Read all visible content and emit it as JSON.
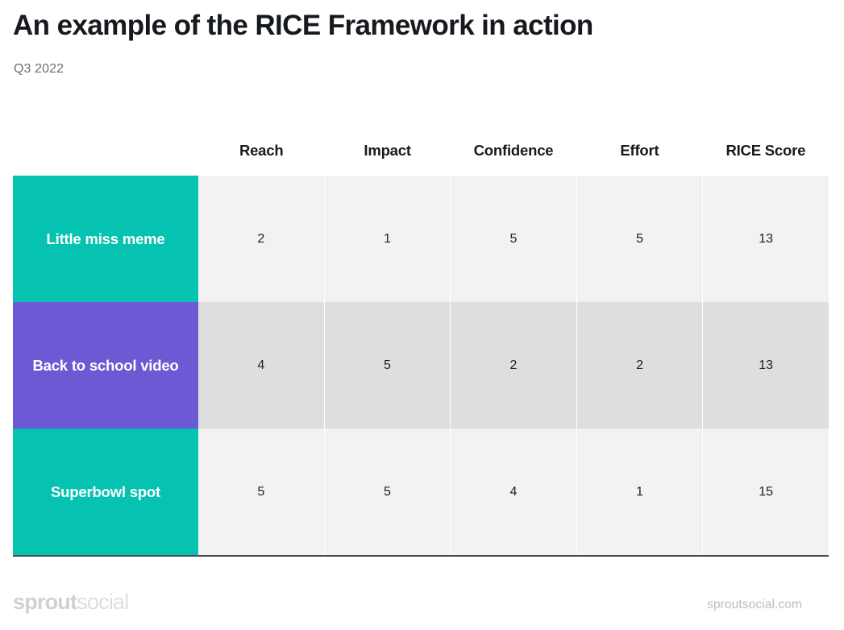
{
  "header": {
    "title": "An example of the RICE Framework in action",
    "subtitle": "Q3 2022"
  },
  "footer": {
    "logo_bold": "sprout",
    "logo_light": "social",
    "url": "sproutsocial.com"
  },
  "colors": {
    "teal": "#05c3b0",
    "purple": "#6c5ad4",
    "row_light": "#f2f2f2",
    "row_dark": "#dedede",
    "text_dark": "#16191d",
    "subtitle_gray": "#6a6f75",
    "logo_gray": "#d2d4d6",
    "table_bottom_rule": "#4a4f55"
  },
  "chart_data": {
    "type": "table",
    "title": "An example of the RICE Framework in action",
    "subtitle": "Q3 2022",
    "row_header_label": "",
    "categories": [
      "Reach",
      "Impact",
      "Confidence",
      "Effort",
      "RICE Score"
    ],
    "rows": [
      {
        "label": "Little miss meme",
        "color": "#05c3b0",
        "shade": "light",
        "values": [
          2,
          1,
          5,
          5,
          13
        ]
      },
      {
        "label": "Back to school video",
        "color": "#6c5ad4",
        "shade": "dark",
        "values": [
          4,
          5,
          2,
          2,
          13
        ]
      },
      {
        "label": "Superbowl spot",
        "color": "#05c3b0",
        "shade": "light",
        "values": [
          5,
          5,
          4,
          1,
          15
        ]
      }
    ]
  }
}
